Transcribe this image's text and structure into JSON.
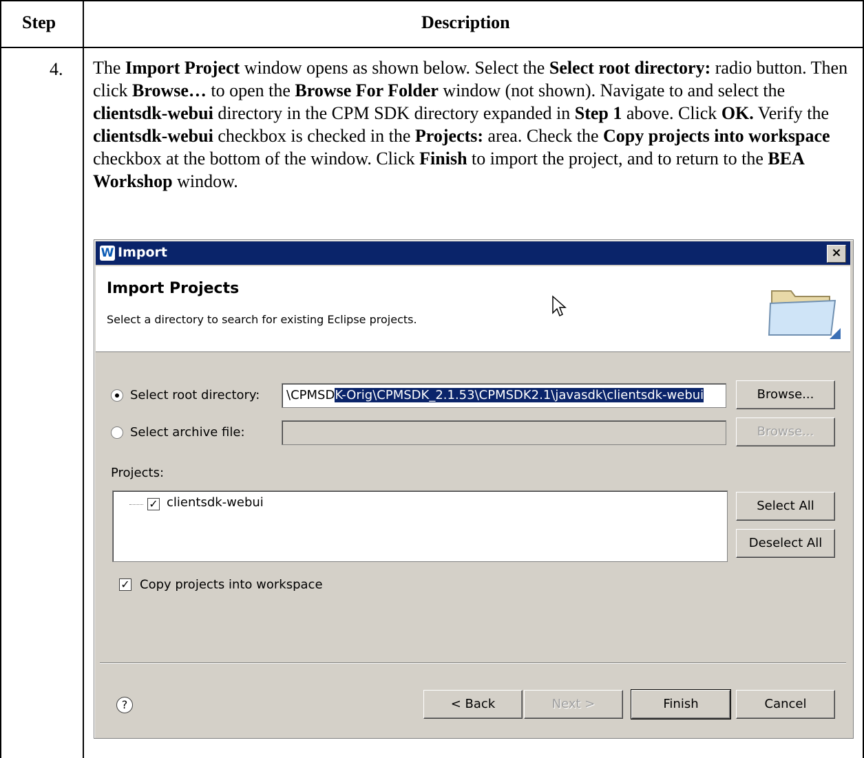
{
  "table": {
    "col1_header": "Step",
    "col2_header": "Description",
    "step_number": "4."
  },
  "instructions": [
    {
      "text": "The ",
      "bold": false
    },
    {
      "text": "Import Project",
      "bold": true
    },
    {
      "text": " window opens as shown below. Select the ",
      "bold": false
    },
    {
      "text": "Select root directory:",
      "bold": true
    },
    {
      "text": " radio button. Then click ",
      "bold": false
    },
    {
      "text": "Browse…",
      "bold": true
    },
    {
      "text": " to open the ",
      "bold": false
    },
    {
      "text": "Browse For Folder",
      "bold": true
    },
    {
      "text": " window (not shown). Navigate to and select the ",
      "bold": false
    },
    {
      "text": "clientsdk-webui",
      "bold": true
    },
    {
      "text": " directory in the CPM SDK directory expanded in ",
      "bold": false
    },
    {
      "text": "Step 1",
      "bold": true
    },
    {
      "text": " above. Click ",
      "bold": false
    },
    {
      "text": "OK.",
      "bold": true
    },
    {
      "text": " Verify the ",
      "bold": false
    },
    {
      "text": "clientsdk-webui",
      "bold": true
    },
    {
      "text": " checkbox is checked in the ",
      "bold": false
    },
    {
      "text": "Projects:",
      "bold": true
    },
    {
      "text": " area. Check the ",
      "bold": false
    },
    {
      "text": "Copy projects into workspace",
      "bold": true
    },
    {
      "text": " checkbox at the bottom of the window. Click ",
      "bold": false
    },
    {
      "text": "Finish",
      "bold": true
    },
    {
      "text": " to import the project, and to return to the ",
      "bold": false
    },
    {
      "text": "BEA Workshop",
      "bold": true
    },
    {
      "text": " window.",
      "bold": false
    }
  ],
  "dialog": {
    "logo_letter": "W",
    "title": "Import",
    "close_glyph": "×",
    "banner_title": "Import Projects",
    "banner_desc": "Select a directory to search for existing Eclipse projects.",
    "root_dir_label": "Select root directory:",
    "root_dir_selected": true,
    "root_dir_value_pre": "\\CPMSD",
    "root_dir_value_sel": "K-Orig\\CPMSDK_2.1.53\\CPMSDK2.1\\javasdk\\clientsdk-webui",
    "archive_label": "Select archive file:",
    "archive_selected": false,
    "archive_value": "",
    "browse_label": "Browse...",
    "projects_label": "Projects:",
    "projects": [
      {
        "name": "clientsdk-webui",
        "checked": true
      }
    ],
    "select_all_label": "Select All",
    "deselect_all_label": "Deselect All",
    "copy_label": "Copy projects into workspace",
    "copy_checked": true,
    "help_glyph": "?",
    "back_label": "< Back",
    "next_label": "Next >",
    "finish_label": "Finish",
    "cancel_label": "Cancel",
    "colors": {
      "titlebar": "#0a246a",
      "face": "#d4d0c8",
      "selection": "#0a246a"
    }
  }
}
